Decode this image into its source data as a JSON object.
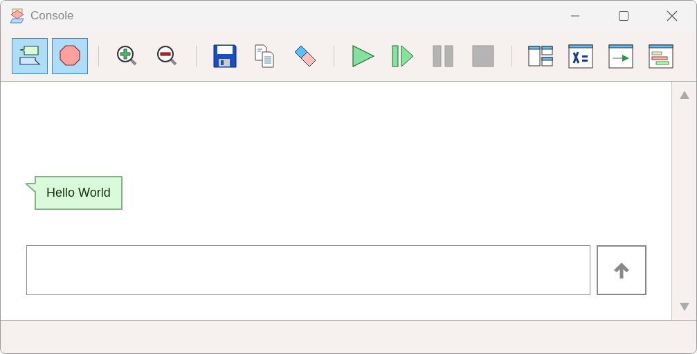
{
  "window": {
    "title": "Console"
  },
  "toolbar": [
    [
      {
        "kind": "bubbles",
        "selected": true,
        "disabled": false
      },
      {
        "kind": "stop-sign",
        "selected": true,
        "disabled": false
      }
    ],
    [
      {
        "kind": "zoom-in",
        "selected": false,
        "disabled": false
      },
      {
        "kind": "zoom-out",
        "selected": false,
        "disabled": false
      }
    ],
    [
      {
        "kind": "save",
        "selected": false,
        "disabled": false
      },
      {
        "kind": "copy",
        "selected": false,
        "disabled": false
      },
      {
        "kind": "eraser",
        "selected": false,
        "disabled": false
      }
    ],
    [
      {
        "kind": "play",
        "selected": false,
        "disabled": false
      },
      {
        "kind": "step",
        "selected": false,
        "disabled": false
      },
      {
        "kind": "pause",
        "selected": false,
        "disabled": true
      },
      {
        "kind": "stop",
        "selected": false,
        "disabled": true
      }
    ],
    [
      {
        "kind": "panels",
        "selected": false,
        "disabled": false
      },
      {
        "kind": "variables",
        "selected": false,
        "disabled": false
      },
      {
        "kind": "output",
        "selected": false,
        "disabled": false
      },
      {
        "kind": "timeline",
        "selected": false,
        "disabled": false
      }
    ]
  ],
  "messages": [
    {
      "text": "Hello World"
    }
  ]
}
